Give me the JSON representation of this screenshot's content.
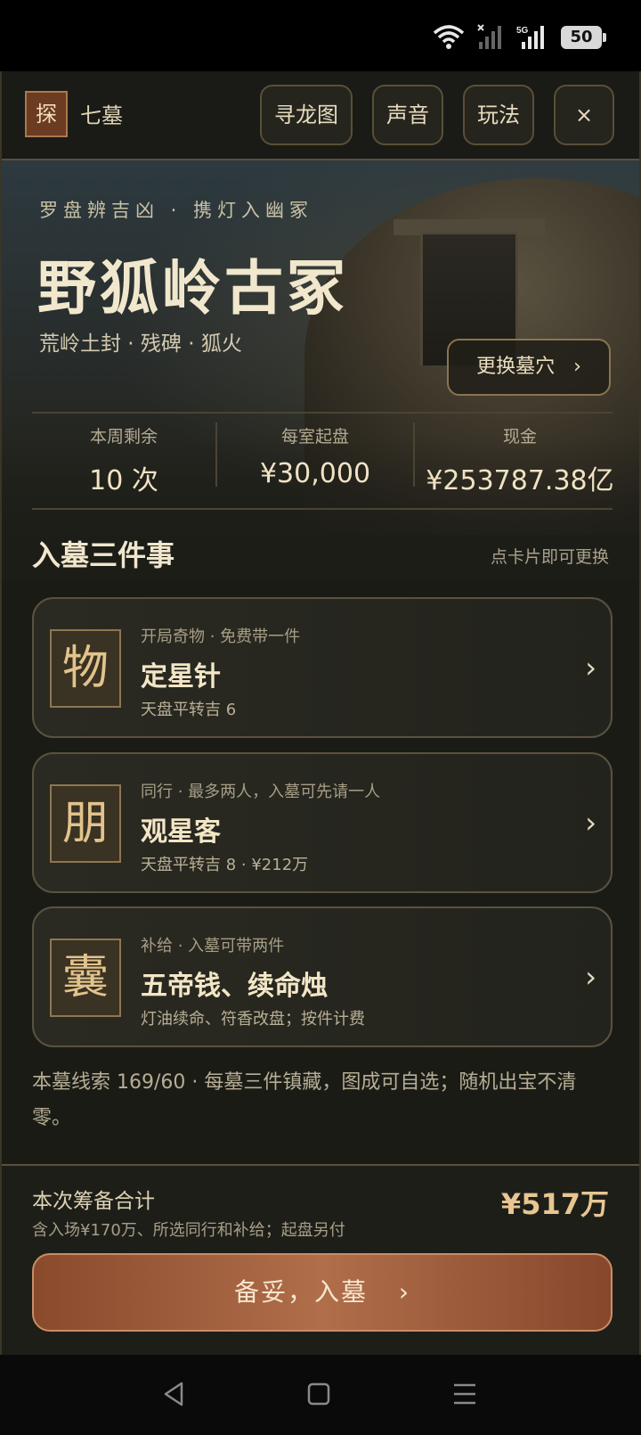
{
  "status_bar": {
    "network_label": "5G",
    "battery": "50",
    "icons": [
      "wifi-icon",
      "no-signal-icon",
      "signal-5g-icon",
      "battery-icon"
    ]
  },
  "header": {
    "logo_char": "探",
    "title": "七墓",
    "buttons": {
      "map": "寻龙图",
      "sound": "声音",
      "rules": "玩法",
      "close": "×"
    }
  },
  "hero": {
    "tagline": "罗盘辨吉凶 · 携灯入幽冢",
    "title": "野狐岭古冢",
    "subtitle": "荒岭土封 · 残碑 · 狐火",
    "change_button": "更换墓穴",
    "change_chevron": "›"
  },
  "stats": [
    {
      "label": "本周剩余",
      "value": "10 次"
    },
    {
      "label": "每室起盘",
      "value": "¥30,000"
    },
    {
      "label": "现金",
      "value": "¥253787.38亿"
    }
  ],
  "section": {
    "title": "入墓三件事",
    "hint": "点卡片即可更换"
  },
  "cards": [
    {
      "glyph": "物",
      "kicker": "开局奇物 · 免费带一件",
      "name": "定星针",
      "detail": "天盘平转吉 6",
      "arrow": "›"
    },
    {
      "glyph": "朋",
      "kicker": "同行 · 最多两人，入墓可先请一人",
      "name": "观星客",
      "detail": "天盘平转吉 8 · ¥212万",
      "arrow": "›"
    },
    {
      "glyph": "囊",
      "kicker": "补给 · 入墓可带两件",
      "name": "五帝钱、续命烛",
      "detail": "灯油续命、符香改盘；按件计费",
      "arrow": "›"
    }
  ],
  "clue_text": "本墓线索 169/60 · 每墓三件镇藏，图成可自选；随机出宝不清零。",
  "footer": {
    "total_label": "本次筹备合计",
    "total_sub": "含入场¥170万、所选同行和补给；起盘另付",
    "total_amount": "¥517万",
    "enter_button": "备妥，入墓",
    "enter_chevron": "›"
  },
  "colors": {
    "background": "#1b1b16",
    "accent_gold": "#e7c691",
    "button_copper": "#b06e4a",
    "border": "#5a5240"
  }
}
